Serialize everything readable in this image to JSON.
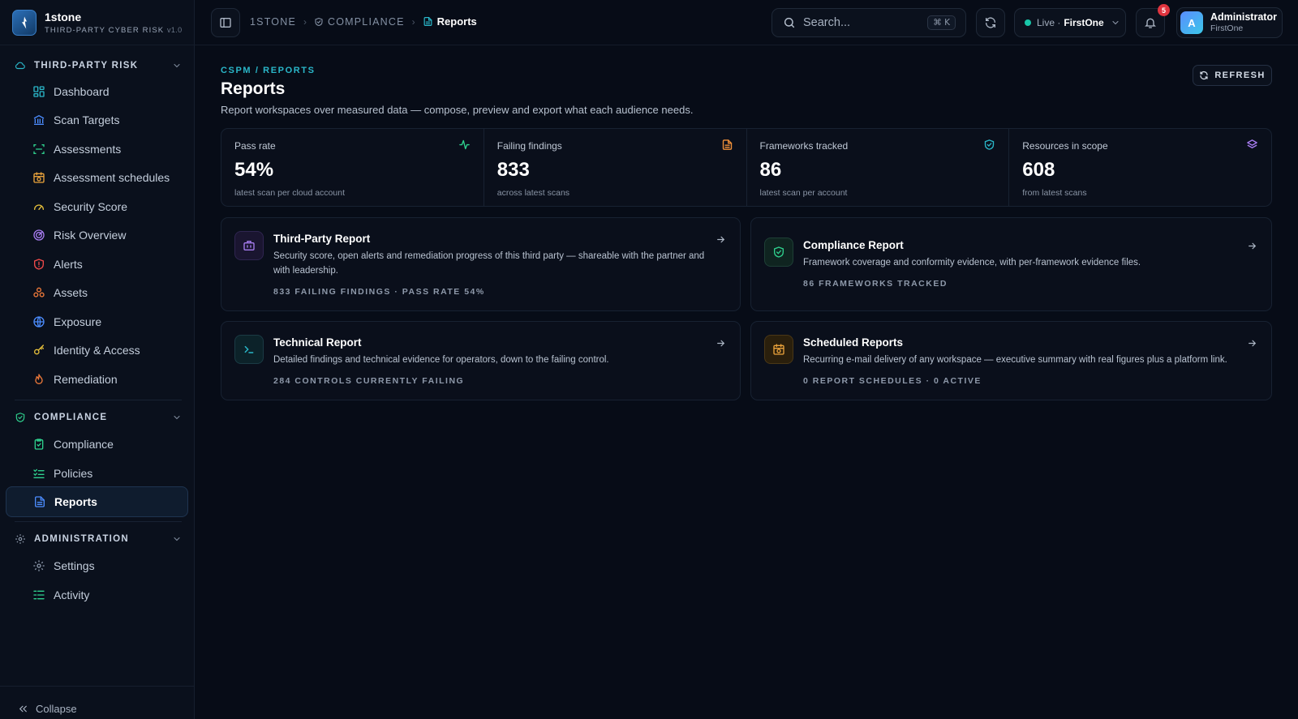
{
  "brand": {
    "name": "1stone",
    "subtitle": "THIRD-PARTY CYBER RISK",
    "version": "v1.0"
  },
  "sidebar": {
    "sections": [
      {
        "title": "THIRD-PARTY RISK",
        "items": [
          {
            "label": "Dashboard",
            "icon": "dashboard-icon"
          },
          {
            "label": "Scan Targets",
            "icon": "bank-icon"
          },
          {
            "label": "Assessments",
            "icon": "scan-icon"
          },
          {
            "label": "Assessment schedules",
            "icon": "calendar-clock-icon"
          },
          {
            "label": "Security Score",
            "icon": "gauge-icon"
          },
          {
            "label": "Risk Overview",
            "icon": "radar-icon"
          },
          {
            "label": "Alerts",
            "icon": "shield-alert-icon"
          },
          {
            "label": "Assets",
            "icon": "boxes-icon"
          },
          {
            "label": "Exposure",
            "icon": "globe-icon"
          },
          {
            "label": "Identity & Access",
            "icon": "key-icon"
          },
          {
            "label": "Remediation",
            "icon": "flame-icon"
          }
        ]
      },
      {
        "title": "COMPLIANCE",
        "items": [
          {
            "label": "Compliance",
            "icon": "clipboard-check-icon"
          },
          {
            "label": "Policies",
            "icon": "list-checks-icon"
          },
          {
            "label": "Reports",
            "icon": "file-text-icon",
            "active": true
          }
        ]
      },
      {
        "title": "ADMINISTRATION",
        "items": [
          {
            "label": "Settings",
            "icon": "gear-icon"
          },
          {
            "label": "Activity",
            "icon": "list-tree-icon"
          }
        ]
      }
    ],
    "collapse_label": "Collapse"
  },
  "topbar": {
    "breadcrumbs": [
      "1STONE",
      "COMPLIANCE",
      "Reports"
    ],
    "search": {
      "placeholder": "Search...",
      "shortcut": "⌘ K"
    },
    "environment": {
      "status": "Live ·",
      "org": "FirstOne"
    },
    "notifications_count": "5",
    "user": {
      "initial": "A",
      "name": "Administrator",
      "org": "FirstOne"
    }
  },
  "page": {
    "eyebrow": "CSPM / REPORTS",
    "title": "Reports",
    "description": "Report workspaces over measured data — compose, preview and export what each audience needs.",
    "refresh_label": "REFRESH"
  },
  "stats": [
    {
      "label": "Pass rate",
      "value": "54%",
      "note": "latest scan per cloud account",
      "icon": "activity-icon",
      "color": "#2fd18e"
    },
    {
      "label": "Failing findings",
      "value": "833",
      "note": "across latest scans",
      "icon": "file-warning-icon",
      "color": "#f0903a"
    },
    {
      "label": "Frameworks tracked",
      "value": "86",
      "note": "latest scan per account",
      "icon": "shield-check-icon",
      "color": "#2ab7c9"
    },
    {
      "label": "Resources in scope",
      "value": "608",
      "note": "from latest scans",
      "icon": "layers-icon",
      "color": "#a77cf0"
    }
  ],
  "reports": [
    {
      "title": "Third-Party Report",
      "description": "Security score, open alerts and remediation progress of this third party — shareable with the partner and with leadership.",
      "meta": "833 FAILING FINDINGS · PASS RATE 54%",
      "icon": "briefcase-icon",
      "color": "#a77cf0"
    },
    {
      "title": "Compliance Report",
      "description": "Framework coverage and conformity evidence, with per-framework evidence files.",
      "meta": "86 FRAMEWORKS TRACKED",
      "icon": "shield-check-icon",
      "color": "#2fd18e"
    },
    {
      "title": "Technical Report",
      "description": "Detailed findings and technical evidence for operators, down to the failing control.",
      "meta": "284 CONTROLS CURRENTLY FAILING",
      "icon": "terminal-icon",
      "color": "#2ab7c9"
    },
    {
      "title": "Scheduled Reports",
      "description": "Recurring e-mail delivery of any workspace — executive summary with real figures plus a platform link.",
      "meta": "0 REPORT SCHEDULES · 0 ACTIVE",
      "icon": "calendar-clock-icon",
      "color": "#e9a23b"
    }
  ]
}
